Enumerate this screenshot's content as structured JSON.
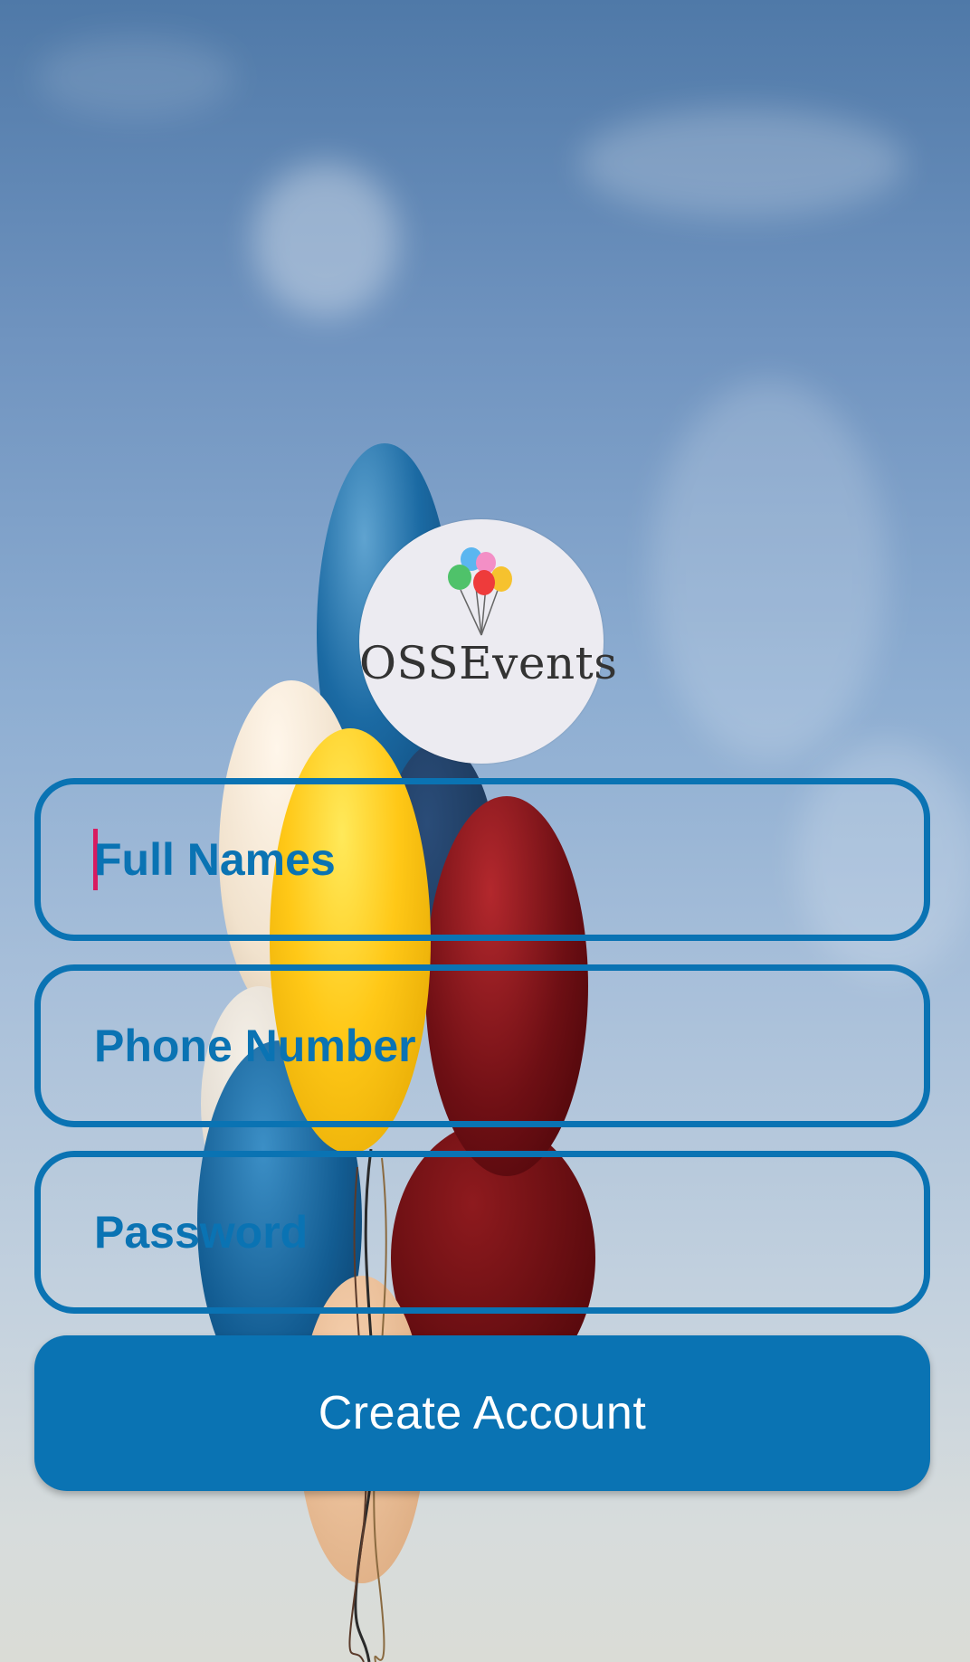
{
  "logo": {
    "brand_text": "OSSEvents",
    "icon": "balloons-bunch-icon"
  },
  "form": {
    "full_names": {
      "placeholder": "Full Names",
      "value": ""
    },
    "phone_number": {
      "placeholder": "Phone Number",
      "value": ""
    },
    "password": {
      "placeholder": "Password",
      "value": ""
    },
    "submit_label": "Create Account"
  },
  "theme": {
    "accent": "#0a73b3",
    "caret": "#d81b60",
    "button_text": "#ffffff"
  }
}
